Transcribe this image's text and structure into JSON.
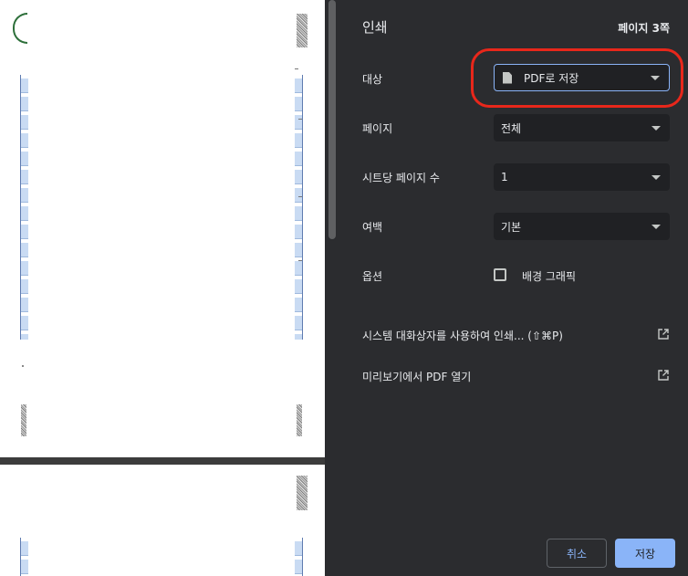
{
  "panel": {
    "title": "인쇄",
    "page_count": "페이지 3쪽",
    "destination": {
      "label": "대상",
      "value": "PDF로 저장",
      "icon": "file-icon"
    },
    "pages": {
      "label": "페이지",
      "value": "전체"
    },
    "pages_per_sheet": {
      "label": "시트당 페이지 수",
      "value": "1"
    },
    "margins": {
      "label": "여백",
      "value": "기본"
    },
    "options": {
      "label": "옵션",
      "background_graphics": "배경 그래픽",
      "background_graphics_checked": false
    },
    "system_dialog": "시스템 대화상자를 사용하여 인쇄... (⇧⌘P)",
    "open_preview": "미리보기에서 PDF 열기",
    "cancel": "취소",
    "save": "저장"
  },
  "colors": {
    "panel_bg": "#2b2c2f",
    "field_bg": "#202124",
    "accent": "#8ab4f8",
    "highlight_ring": "#e8271b"
  }
}
